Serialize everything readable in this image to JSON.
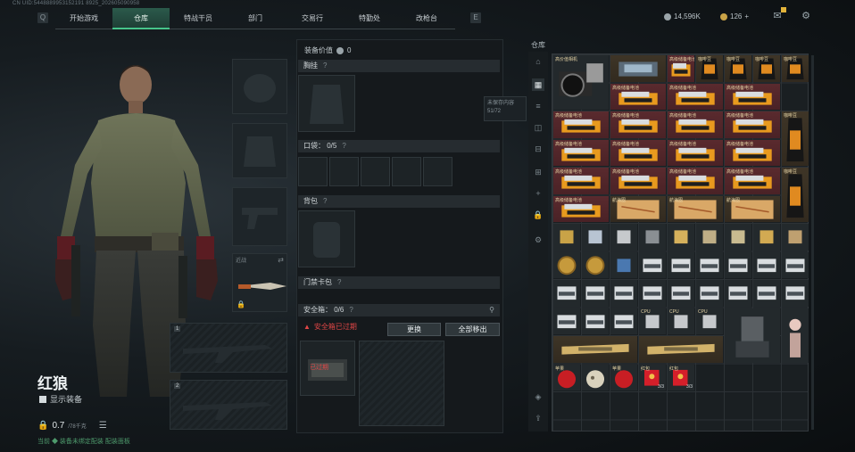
{
  "uid": "CN UID:5448889953152191 8925_202605090958",
  "nav": {
    "tabs": [
      {
        "label": "开始游戏",
        "active": false,
        "badge": false
      },
      {
        "label": "仓库",
        "active": true,
        "badge": false
      },
      {
        "label": "特战干员",
        "active": false,
        "badge": true
      },
      {
        "label": "部门",
        "active": false,
        "badge": true
      },
      {
        "label": "交易行",
        "active": false,
        "badge": false
      },
      {
        "label": "特勤处",
        "active": false,
        "badge": true
      },
      {
        "label": "改枪台",
        "active": false,
        "badge": false
      }
    ],
    "prev_icon": "Q",
    "next_icon": "E"
  },
  "currency": {
    "silver": "14,596K",
    "gold": "126",
    "add": "+"
  },
  "character": {
    "name": "红狼",
    "show_equipment": "显示装备",
    "weight": "0.7",
    "weight_max": "/78千克",
    "hint": "当前 ◆ 装备未绑定配装 配装面板"
  },
  "equipment": {
    "melee_label": "近战"
  },
  "middle": {
    "equip_value_label": "装备价值",
    "equip_value": "0",
    "sections": {
      "chest": "胸挂",
      "pocket": "口袋：",
      "pocket_count": "0/5",
      "backpack": "背包",
      "keycard": "门禁卡包",
      "safe": "安全箱：",
      "safe_count": "0/6"
    },
    "safe_warning": "安全箱已过期",
    "btn_replace": "更换",
    "btn_move_all": "全部移出",
    "expired_tag": "已过期",
    "help": "?"
  },
  "tooltip": {
    "line1": "未保存内容",
    "line2": "51/72"
  },
  "warehouse": {
    "title": "仓库",
    "labels": {
      "camera": "高价值相机",
      "battery": "高级储备电池",
      "coffee": "咖啡豆",
      "cpu": "CPU",
      "map": "航海图",
      "apple": "苹果",
      "redpack": "红包"
    },
    "counts": {
      "redpack": "3/3"
    }
  },
  "colors": {
    "accent": "#46c48a",
    "warning": "#e04646",
    "badge": "#e2b33a"
  }
}
